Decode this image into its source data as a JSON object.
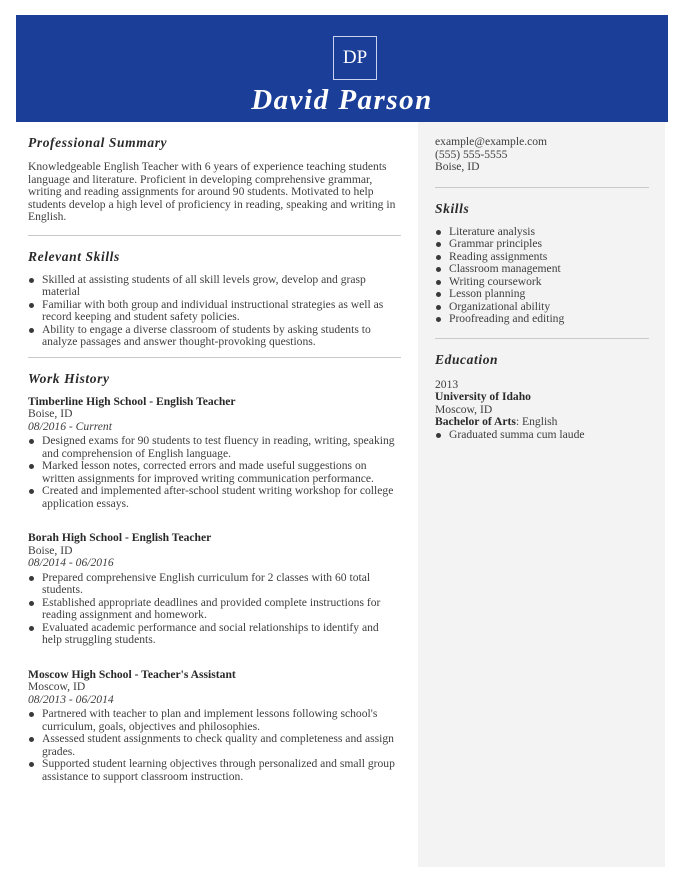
{
  "header": {
    "monogram": "DP",
    "name": "David Parson",
    "background_color": "#1b3e98"
  },
  "summary": {
    "title": "Professional Summary",
    "text": "Knowledgeable English Teacher with 6 years of experience teaching students language and literature. Proficient in developing comprehensive grammar, writing and reading assignments for around 90 students. Motivated to help students develop a high level of proficiency in reading, speaking and writing in English."
  },
  "relevant_skills": {
    "title": "Relevant Skills",
    "items": [
      "Skilled at assisting students of all skill levels grow, develop and grasp material",
      "Familiar with both group and individual instructional strategies as well as record keeping and student safety policies.",
      "Ability to engage a diverse classroom of students by asking students to analyze passages and answer thought-provoking questions."
    ]
  },
  "work_history": {
    "title": "Work History",
    "jobs": [
      {
        "company": "Timberline High School",
        "sep": " - ",
        "role": "English Teacher",
        "location": "Boise, ID",
        "dates": "08/2016 - Current",
        "bullets": [
          "Designed exams for 90 students to test fluency in reading, writing, speaking and comprehension of English language.",
          "Marked lesson notes, corrected errors and made useful suggestions on written assignments for improved writing communication performance.",
          "Created and implemented after-school student writing workshop for college application essays."
        ]
      },
      {
        "company": "Borah High School",
        "sep": " - ",
        "role": "English Teacher",
        "location": "Boise, ID",
        "dates": "08/2014 - 06/2016",
        "bullets": [
          "Prepared comprehensive English curriculum for 2 classes with 60 total students.",
          "Established appropriate deadlines and provided complete instructions for reading assignment and homework.",
          "Evaluated academic performance and social relationships to identify and help struggling students."
        ]
      },
      {
        "company": "Moscow High School",
        "sep": " - ",
        "role": "Teacher's Assistant",
        "location": "Moscow, ID",
        "dates": "08/2013 - 06/2014",
        "bullets": [
          "Partnered with teacher to plan and implement lessons following school's curriculum, goals, objectives and philosophies.",
          "Assessed student assignments to check quality and completeness and assign grades.",
          "Supported student learning objectives through personalized and small group assistance to support classroom instruction."
        ]
      }
    ]
  },
  "contact": {
    "email": "example@example.com",
    "phone": "(555) 555-5555",
    "location": "Boise, ID"
  },
  "skills": {
    "title": "Skills",
    "items": [
      "Literature analysis",
      "Grammar principles",
      "Reading assignments",
      "Classroom management",
      "Writing coursework",
      "Lesson planning",
      "Organizational ability",
      "Proofreading and editing"
    ]
  },
  "education": {
    "title": "Education",
    "year": "2013",
    "school": "University of Idaho",
    "location": "Moscow, ID",
    "degree": "Bachelor of Arts",
    "field": ": English",
    "bullets": [
      "Graduated summa cum laude"
    ]
  }
}
